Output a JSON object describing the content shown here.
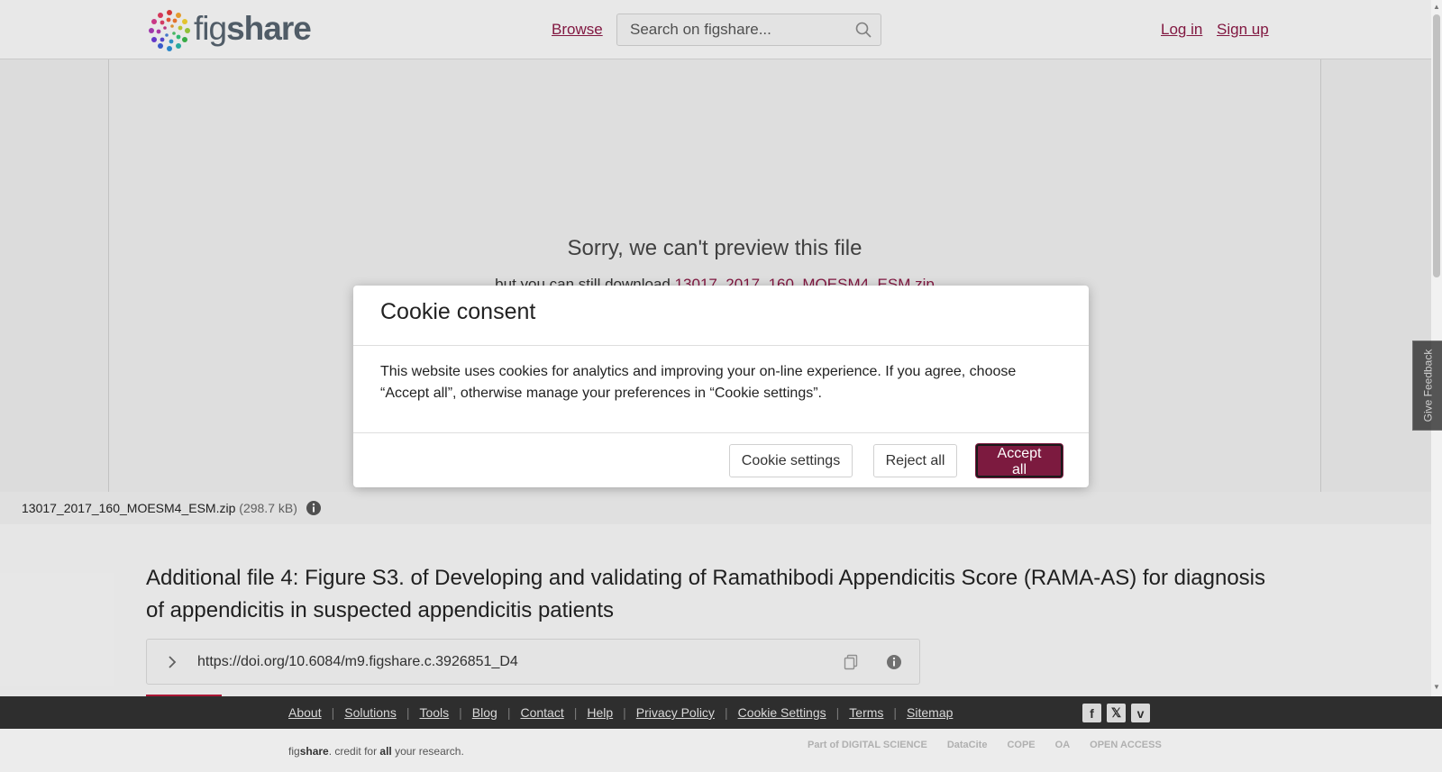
{
  "header": {
    "logo_text_light": "fig",
    "logo_text_bold": "share",
    "browse_label": "Browse",
    "search_placeholder": "Search on figshare...",
    "login_label": "Log in",
    "signup_label": "Sign up"
  },
  "preview": {
    "message": "Sorry, we can't preview this file",
    "download_prefix": "but you can still download ",
    "download_filename": "13017_2017_160_MOESM4_ESM.zip"
  },
  "file_bar": {
    "file_name": "13017_2017_160_MOESM4_ESM.zip",
    "file_size": "(298.7 kB)"
  },
  "main": {
    "title": "Additional file 4: Figure S3. of Developing and validating of Ramathibodi Appendicitis Score (RAMA-AS) for diagnosis of appendicitis in suspected appendicitis patients",
    "doi": "https://doi.org/10.6084/m9.figshare.c.3926851_D4"
  },
  "feedback_label": "Give Feedback",
  "cookie_modal": {
    "title": "Cookie consent",
    "body": "This website uses cookies for analytics and improving your on-line experience. If you agree, choose “Accept all”, otherwise manage your preferences in “Cookie settings”.",
    "settings_label": "Cookie settings",
    "reject_label": "Reject all",
    "accept_label": "Accept all"
  },
  "footer": {
    "links": [
      "About",
      "Solutions",
      "Tools",
      "Blog",
      "Contact",
      "Help",
      "Privacy Policy",
      "Cookie Settings",
      "Terms",
      "Sitemap"
    ],
    "social": [
      "facebook-icon",
      "x-icon",
      "vimeo-icon"
    ],
    "tagline_prefix": "fig",
    "tagline_bold": "share",
    "tagline_mid": ". credit for ",
    "tagline_all": "all",
    "tagline_suffix": " your research.",
    "partners": [
      "Part of DIGITAL SCIENCE",
      "DataCite",
      "COPE",
      "OA",
      "OPEN ACCESS"
    ]
  },
  "colors": {
    "brand": "#8a1a46",
    "accept_bg": "#7c1a3f",
    "footer_dark": "#2e2e2e"
  }
}
